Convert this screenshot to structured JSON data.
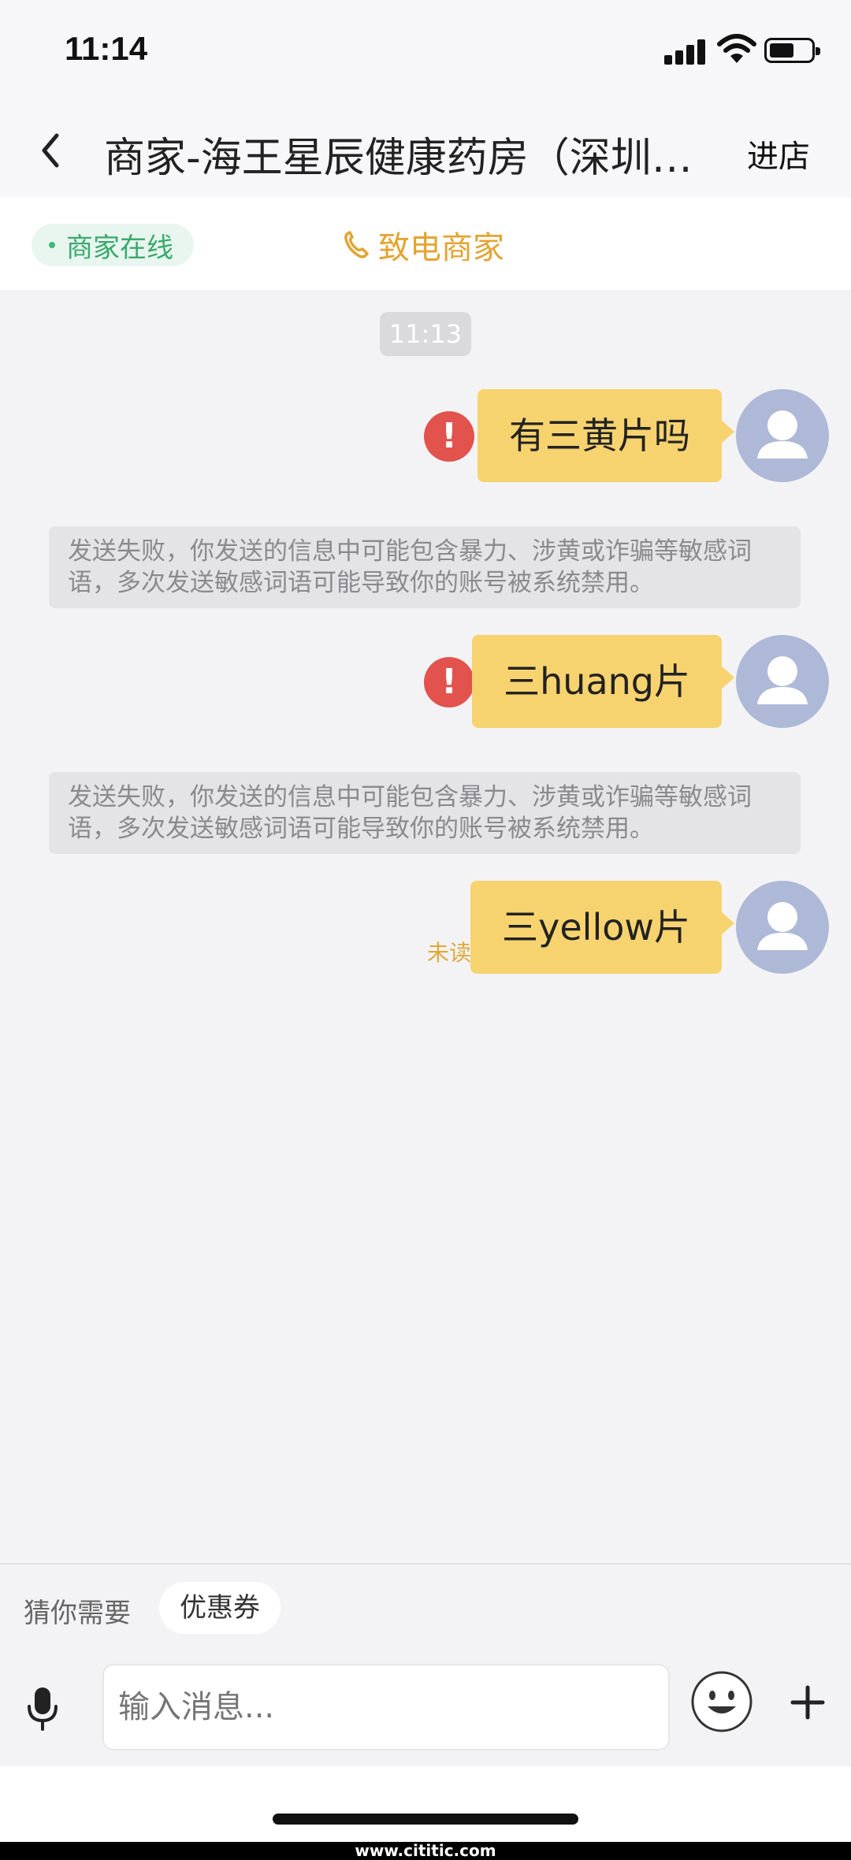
{
  "status_bar": {
    "time": "11:14"
  },
  "nav": {
    "title": "商家-海王星辰健康药房（深圳…",
    "enter_store": "进店"
  },
  "info_bar": {
    "online_status": "商家在线",
    "call_label": "致电商家",
    "colors": {
      "online": "#3aa96e",
      "call": "#e3a432"
    }
  },
  "chat": {
    "timestamp": "11:13",
    "messages": [
      {
        "text": "有三黄片吗",
        "status": "failed",
        "error_icon": "exclamation-icon"
      },
      {
        "text": "三huang片",
        "status": "failed",
        "error_icon": "exclamation-icon"
      },
      {
        "text": "三yellow片",
        "status": "unread",
        "status_label": "未读"
      }
    ],
    "notices": [
      "发送失败，你发送的信息中可能包含暴力、涉黄或诈骗等敏感词语，多次发送敏感词语可能导致你的账号被系统禁用。",
      "发送失败，你发送的信息中可能包含暴力、涉黄或诈骗等敏感词语，多次发送敏感词语可能导致你的账号被系统禁用。"
    ],
    "bubble_color": "#f7d36f"
  },
  "suggestions": {
    "label": "猜你需要",
    "chips": [
      "优惠券"
    ]
  },
  "input": {
    "placeholder": "输入消息..."
  },
  "footer": {
    "watermark": "www.cititic.com"
  }
}
